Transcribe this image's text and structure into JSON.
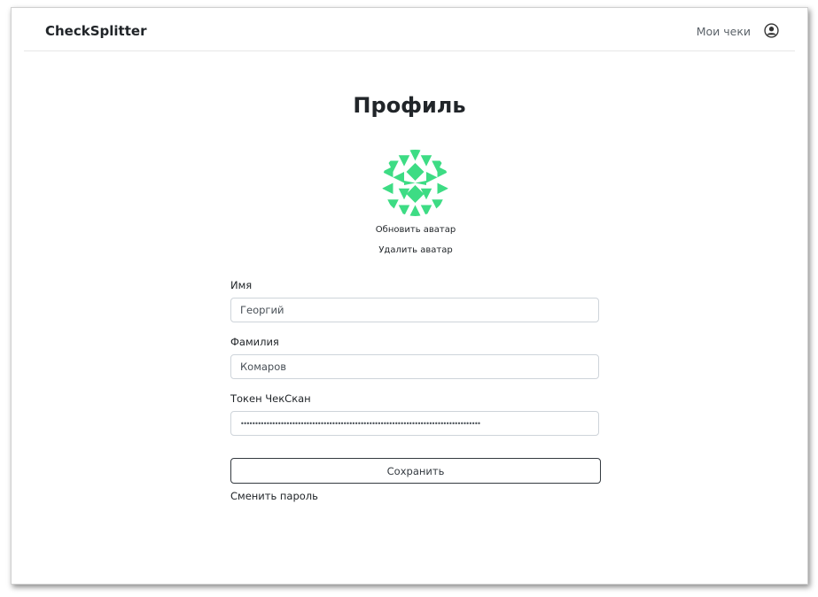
{
  "navbar": {
    "brand": "CheckSplitter",
    "my_checks": "Мои чеки",
    "user_icon": "user-circle-icon"
  },
  "page": {
    "title": "Профиль"
  },
  "avatar": {
    "image_icon": "identicon-avatar",
    "color": "#3ddc84",
    "update_label": "Обновить аватар",
    "delete_label": "Удалить аватар"
  },
  "form": {
    "first_name": {
      "label": "Имя",
      "value": "Георгий"
    },
    "last_name": {
      "label": "Фамилия",
      "value": "Комаров"
    },
    "token": {
      "label": "Токен ЧекСкан",
      "value": "••••••••••••••••••••••••••••••••••••••••••••••••••••••••••••••••••••••••••••••••••••"
    },
    "save_label": "Сохранить",
    "change_password_label": "Сменить пароль"
  }
}
